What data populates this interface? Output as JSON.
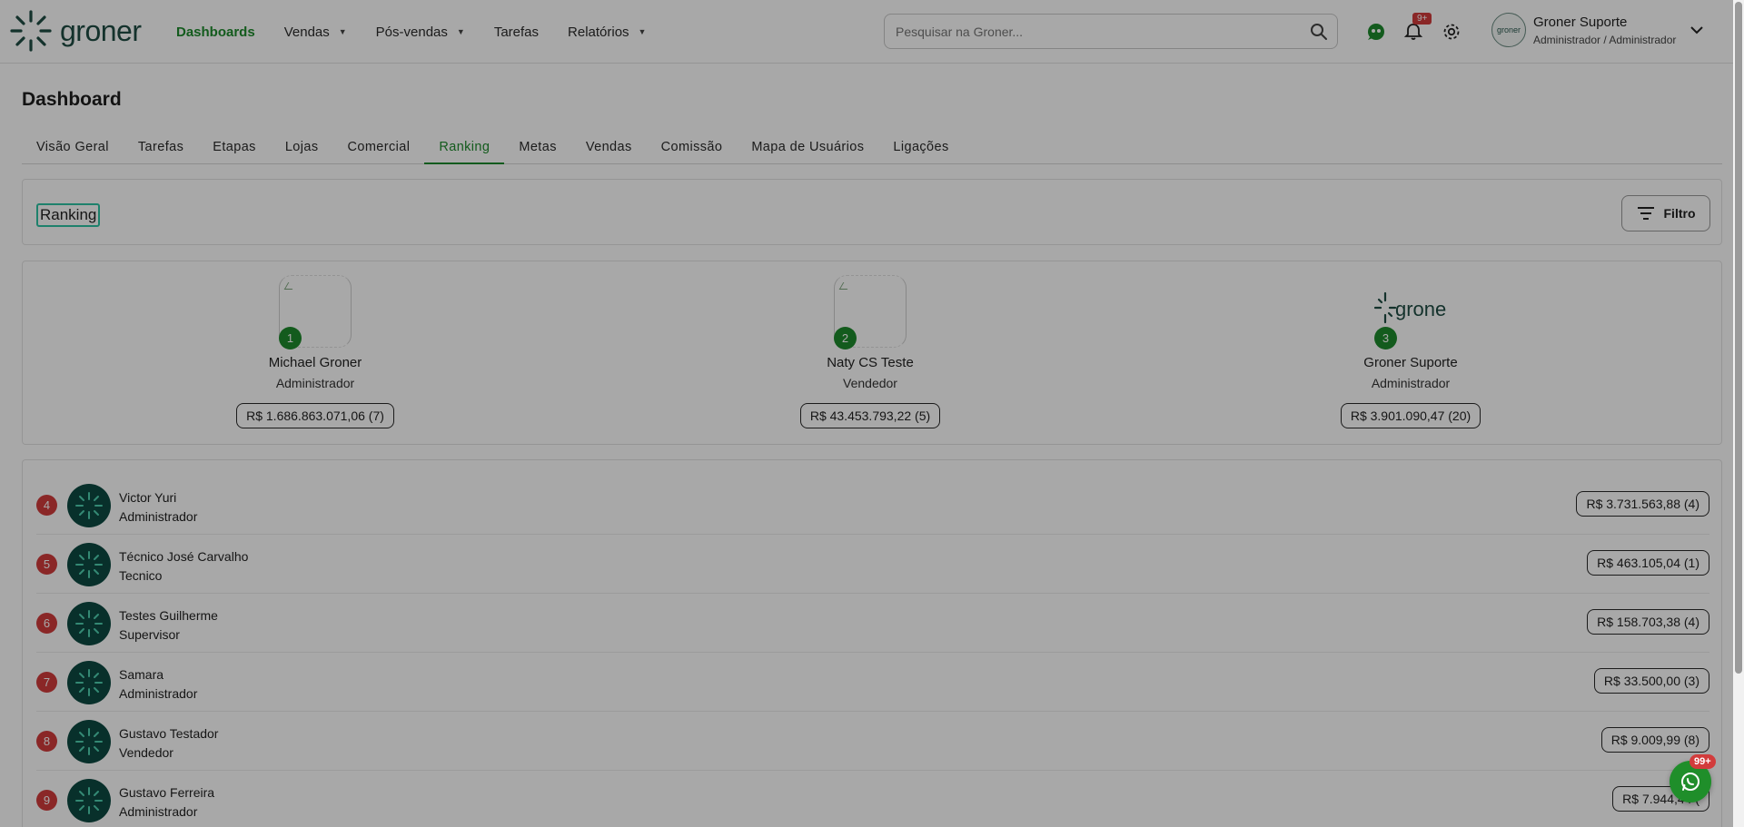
{
  "brand": {
    "name": "groner"
  },
  "nav": [
    {
      "label": "Dashboards",
      "active": true,
      "dropdown": false
    },
    {
      "label": "Vendas",
      "active": false,
      "dropdown": true
    },
    {
      "label": "Pós-vendas",
      "active": false,
      "dropdown": true
    },
    {
      "label": "Tarefas",
      "active": false,
      "dropdown": false
    },
    {
      "label": "Relatórios",
      "active": false,
      "dropdown": true
    }
  ],
  "search": {
    "placeholder": "Pesquisar na Groner..."
  },
  "notifications": {
    "badge": "9+"
  },
  "user": {
    "name": "Groner Suporte",
    "role": "Administrador / Administrador",
    "avatar_text": "groner"
  },
  "page": {
    "title": "Dashboard"
  },
  "tabs": [
    {
      "label": "Visão Geral",
      "active": false
    },
    {
      "label": "Tarefas",
      "active": false
    },
    {
      "label": "Etapas",
      "active": false
    },
    {
      "label": "Lojas",
      "active": false
    },
    {
      "label": "Comercial",
      "active": false
    },
    {
      "label": "Ranking",
      "active": true
    },
    {
      "label": "Metas",
      "active": false
    },
    {
      "label": "Vendas",
      "active": false
    },
    {
      "label": "Comissão",
      "active": false
    },
    {
      "label": "Mapa de Usuários",
      "active": false
    },
    {
      "label": "Ligações",
      "active": false
    }
  ],
  "section": {
    "title": "Ranking",
    "filter_label": "Filtro"
  },
  "podium": [
    {
      "rank": "1",
      "name": "Michael Groner",
      "role": "Administrador",
      "amount": "R$ 1.686.863.071,06 (7)",
      "image": "broken"
    },
    {
      "rank": "2",
      "name": "Naty CS Teste",
      "role": "Vendedor",
      "amount": "R$ 43.453.793,22 (5)",
      "image": "broken"
    },
    {
      "rank": "3",
      "name": "Groner Suporte",
      "role": "Administrador",
      "amount": "R$ 3.901.090,47 (20)",
      "image": "brand-logo",
      "logo_text": "groner"
    }
  ],
  "ranking": [
    {
      "rank": "4",
      "name": "Victor Yuri",
      "role": "Administrador",
      "amount": "R$ 3.731.563,88 (4)"
    },
    {
      "rank": "5",
      "name": "Técnico José Carvalho",
      "role": "Tecnico",
      "amount": "R$ 463.105,04 (1)"
    },
    {
      "rank": "6",
      "name": "Testes Guilherme",
      "role": "Supervisor",
      "amount": "R$ 158.703,38 (4)"
    },
    {
      "rank": "7",
      "name": "Samara",
      "role": "Administrador",
      "amount": "R$ 33.500,00 (3)"
    },
    {
      "rank": "8",
      "name": "Gustavo Testador",
      "role": "Vendedor",
      "amount": "R$ 9.009,99 (8)"
    },
    {
      "rank": "9",
      "name": "Gustavo Ferreira",
      "role": "Administrador",
      "amount": "R$ 7.944,44 ("
    }
  ],
  "whatsapp": {
    "badge": "99+"
  },
  "colors": {
    "brand_green": "#1e8a2c",
    "dark_teal": "#0d4a42",
    "rank_red": "#d23c3c",
    "focus_outline": "#2ec4a4"
  }
}
